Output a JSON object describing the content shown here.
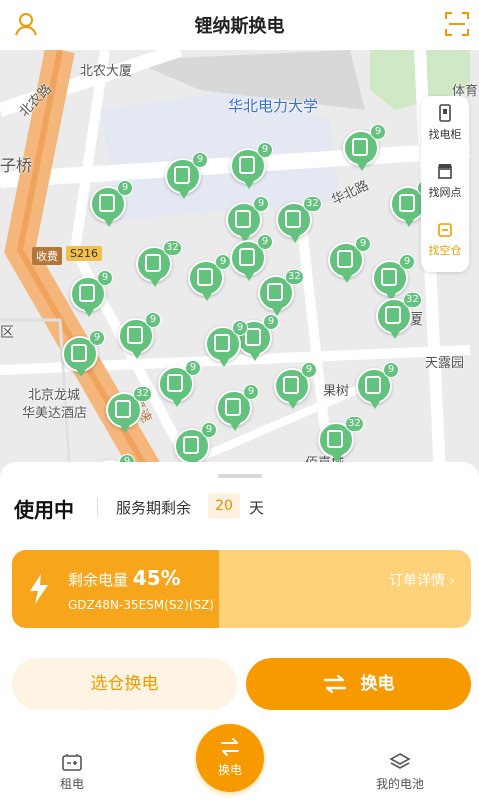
{
  "header": {
    "title": "锂纳斯换电",
    "profile_icon": "user-icon",
    "scan_icon": "scan-icon"
  },
  "map": {
    "labels": [
      "北农大厦",
      "华北电力大学",
      "北农路",
      "子桥",
      "华北路",
      "收费",
      "S216",
      "区",
      "北京龙城",
      "华美达酒店",
      "高速",
      "果树",
      "天露园",
      "佰嘉城",
      "体育",
      "厦"
    ],
    "pins": [
      {
        "count": "9"
      },
      {
        "count": "9"
      },
      {
        "count": "9"
      },
      {
        "count": "9"
      },
      {
        "count": "32"
      },
      {
        "count": "9"
      },
      {
        "count": "32"
      },
      {
        "count": "32"
      },
      {
        "count": "9"
      },
      {
        "count": "9"
      },
      {
        "count": "9"
      },
      {
        "count": "9"
      },
      {
        "count": "9"
      },
      {
        "count": "32"
      },
      {
        "count": "32"
      },
      {
        "count": "9"
      },
      {
        "count": "9"
      },
      {
        "count": "9"
      },
      {
        "count": "9"
      },
      {
        "count": "9"
      },
      {
        "count": "9"
      },
      {
        "count": "32"
      },
      {
        "count": "9"
      },
      {
        "count": "9"
      },
      {
        "count": "9"
      },
      {
        "count": "32"
      },
      {
        "count": "9"
      }
    ]
  },
  "side_menu": [
    {
      "label": "找电柜",
      "icon": "battery-cabinet-icon"
    },
    {
      "label": "找网点",
      "icon": "store-icon"
    },
    {
      "label": "找空仓",
      "icon": "empty-slot-icon"
    }
  ],
  "panel": {
    "status": "使用中",
    "service_label": "服务期剩余",
    "days": "20",
    "days_unit": "天",
    "battery": {
      "label": "剩余电量",
      "percent": "45%",
      "level": 0.45,
      "model": "GDZ48N-35ESM(S2)(SZ)",
      "order_link": "订单详情 ›"
    },
    "select_button": "选仓换电",
    "swap_button": "换电"
  },
  "nav": {
    "left": "租电",
    "center": "换电",
    "right": "我的电池"
  },
  "colors": {
    "accent": "#f79a00",
    "pin": "#63c27e"
  }
}
